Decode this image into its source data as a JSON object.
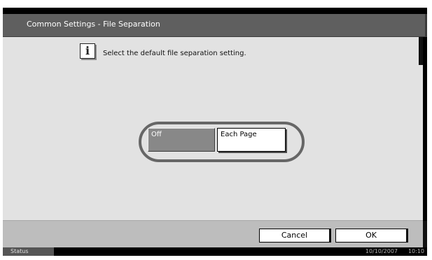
{
  "header": {
    "title": "Common Settings - File Separation"
  },
  "message": {
    "icon": "info-icon",
    "icon_glyph": "i",
    "text": "Select the default file separation setting."
  },
  "options": {
    "off_label": "Off",
    "each_page_label": "Each Page",
    "selected": "Off"
  },
  "footer": {
    "cancel_label": "Cancel",
    "ok_label": "OK"
  },
  "status_bar": {
    "label": "Status",
    "date": "10/10/2007",
    "time": "10:10"
  },
  "colors": {
    "title_bar": "#5f5f5f",
    "content_bg": "#e2e2e2",
    "selected_option": "#888888",
    "footer_bg": "#bdbdbd"
  }
}
